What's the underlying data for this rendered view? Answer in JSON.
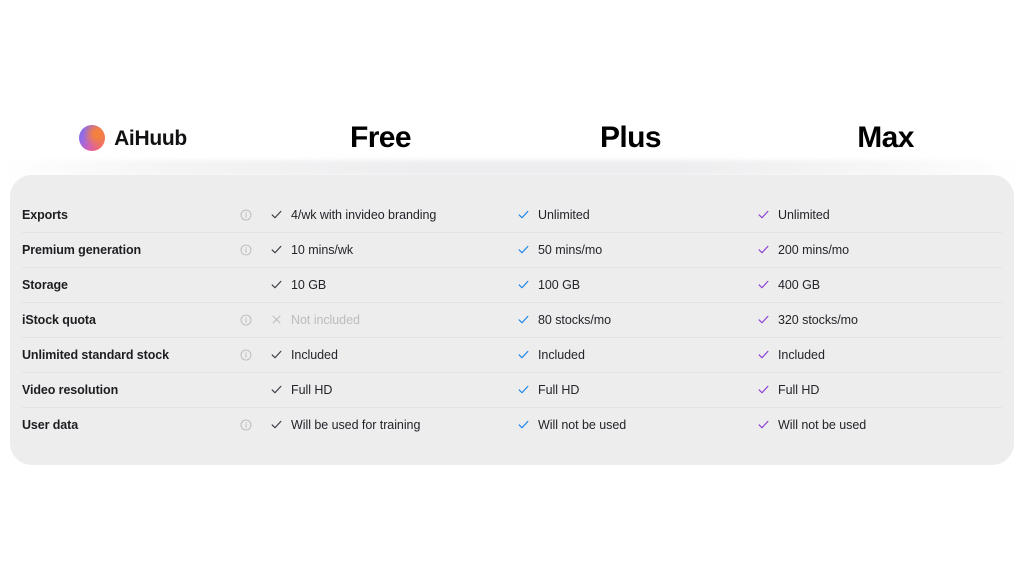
{
  "brand": {
    "name": "AiHuub",
    "logo_icon": "gradient-circle-icon",
    "gradient_from": "#7b6ef0",
    "gradient_to": "#f08a4a"
  },
  "colors": {
    "panel_background": "#ededee",
    "page_background": "#ffffff",
    "row_divider": "#e3e3e5",
    "text_primary": "#1e1e22",
    "text_value": "#24242a",
    "text_muted": "#bcbcc0",
    "check_free": "#3c3c44",
    "check_plus": "#1a85e8",
    "check_max": "#8b3fd4",
    "info_icon": "#b4b4b8"
  },
  "columns": [
    {
      "id": "free",
      "label": "Free"
    },
    {
      "id": "plus",
      "label": "Plus"
    },
    {
      "id": "max",
      "label": "Max"
    }
  ],
  "rows": [
    {
      "feature": "Exports",
      "has_info": true,
      "free": {
        "icon": "check-icon",
        "text": "4/wk with invideo branding",
        "included": true
      },
      "plus": {
        "icon": "check-icon",
        "text": "Unlimited",
        "included": true
      },
      "max": {
        "icon": "check-icon",
        "text": "Unlimited",
        "included": true
      }
    },
    {
      "feature": "Premium generation",
      "has_info": true,
      "free": {
        "icon": "check-icon",
        "text": "10 mins/wk",
        "included": true
      },
      "plus": {
        "icon": "check-icon",
        "text": "50 mins/mo",
        "included": true
      },
      "max": {
        "icon": "check-icon",
        "text": "200 mins/mo",
        "included": true
      }
    },
    {
      "feature": "Storage",
      "has_info": false,
      "free": {
        "icon": "check-icon",
        "text": "10 GB",
        "included": true
      },
      "plus": {
        "icon": "check-icon",
        "text": "100 GB",
        "included": true
      },
      "max": {
        "icon": "check-icon",
        "text": "400 GB",
        "included": true
      }
    },
    {
      "feature": "iStock quota",
      "has_info": true,
      "free": {
        "icon": "cross-icon",
        "text": "Not included",
        "included": false
      },
      "plus": {
        "icon": "check-icon",
        "text": "80 stocks/mo",
        "included": true
      },
      "max": {
        "icon": "check-icon",
        "text": "320 stocks/mo",
        "included": true
      }
    },
    {
      "feature": "Unlimited standard stock",
      "has_info": true,
      "free": {
        "icon": "check-icon",
        "text": "Included",
        "included": true
      },
      "plus": {
        "icon": "check-icon",
        "text": "Included",
        "included": true
      },
      "max": {
        "icon": "check-icon",
        "text": "Included",
        "included": true
      }
    },
    {
      "feature": "Video resolution",
      "has_info": false,
      "free": {
        "icon": "check-icon",
        "text": "Full HD",
        "included": true
      },
      "plus": {
        "icon": "check-icon",
        "text": "Full HD",
        "included": true
      },
      "max": {
        "icon": "check-icon",
        "text": "Full HD",
        "included": true
      }
    },
    {
      "feature": "User data",
      "has_info": true,
      "free": {
        "icon": "check-icon",
        "text": "Will be used for training",
        "included": true
      },
      "plus": {
        "icon": "check-icon",
        "text": "Will not be used",
        "included": true
      },
      "max": {
        "icon": "check-icon",
        "text": "Will not be used",
        "included": true
      }
    }
  ]
}
